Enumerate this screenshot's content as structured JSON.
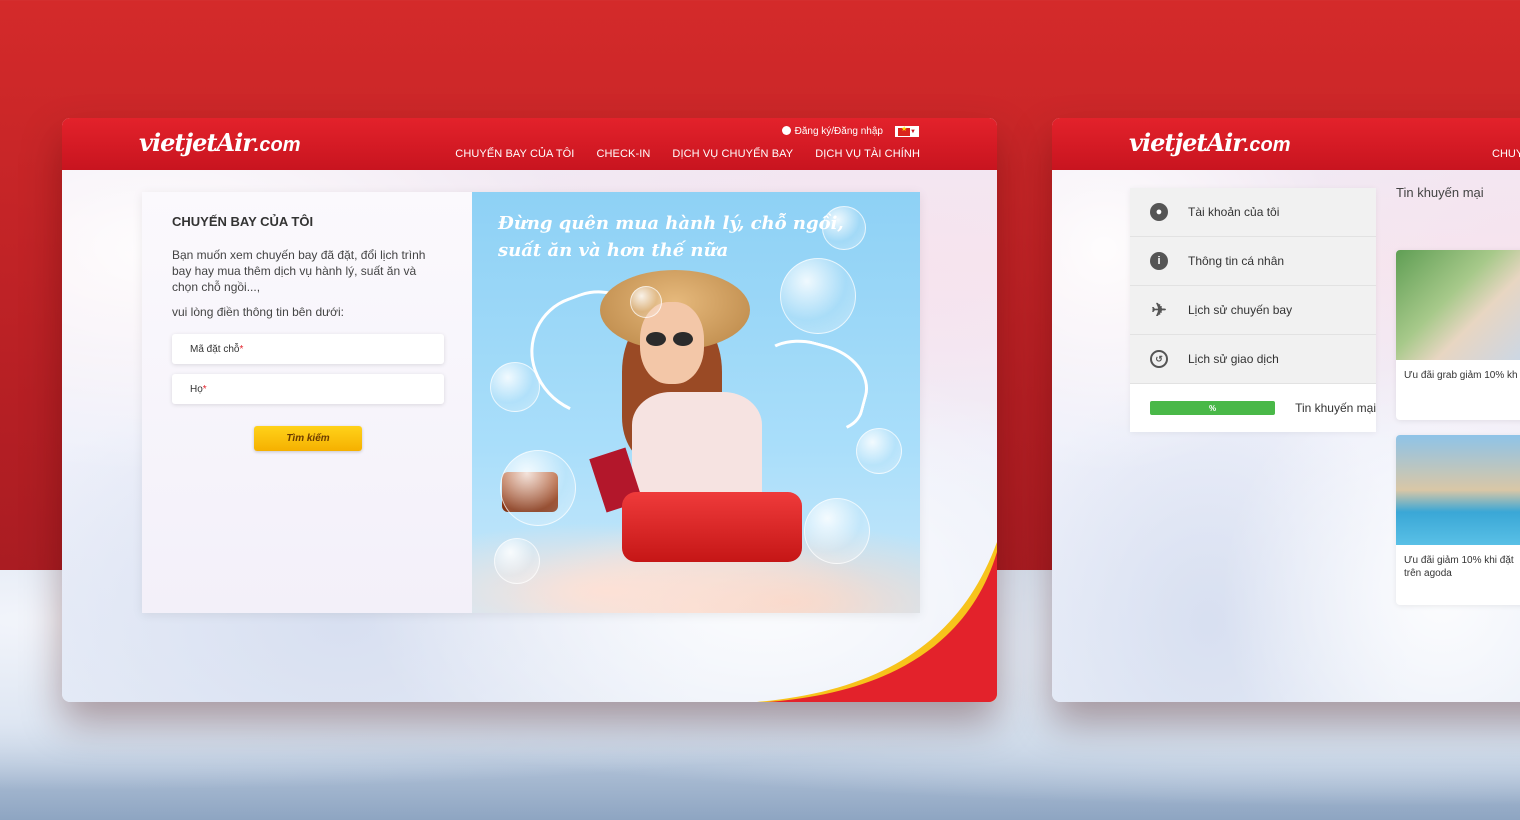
{
  "left_window": {
    "logo": {
      "main": "vietjetAir",
      "suffix": ".com"
    },
    "topbar": {
      "login_label": "Đăng ký/Đăng nhập",
      "flag": "vietnam-flag"
    },
    "nav": [
      "CHUYẾN BAY CỦA TÔI",
      "CHECK-IN",
      "DỊCH VỤ CHUYẾN BAY",
      "DỊCH VỤ TÀI CHÍNH"
    ],
    "form": {
      "title": "CHUYẾN BAY CỦA TÔI",
      "description": "Bạn muốn xem chuyến bay đã đặt, đổi lịch trình bay hay mua thêm dịch vụ hành lý, suất ăn và chọn chỗ ngồi...,",
      "instruction": "vui lòng điền thông tin bên dưới:",
      "booking_code_label": "Mã đặt chỗ",
      "last_name_label": "Họ",
      "required_mark": "*",
      "search_button": "Tìm kiếm"
    },
    "promo_banner": {
      "line1": "Đừng quên mua hành lý, chỗ ngồi,",
      "line2": "suất ăn và hơn thế nữa"
    }
  },
  "right_window": {
    "logo": {
      "main": "vietjetAir",
      "suffix": ".com"
    },
    "nav_partial": "CHUY",
    "sidebar": [
      {
        "label": "Tài khoản của tôi",
        "icon": "account-icon"
      },
      {
        "label": "Thông tin cá nhân",
        "icon": "info-icon"
      },
      {
        "label": "Lịch sử chuyến bay",
        "icon": "plane-icon"
      },
      {
        "label": "Lịch sử giao dịch",
        "icon": "history-icon"
      },
      {
        "label": "Tin khuyến mại",
        "icon": "promo-icon"
      }
    ],
    "promo_title": "Tin khuyến mại",
    "promo_cards": [
      {
        "text": "Ưu đãi grab giảm 10% kh"
      },
      {
        "text": "Ưu đãi giảm 10% khi đặt trên agoda"
      }
    ]
  },
  "colors": {
    "brand_red": "#e3222b",
    "brand_yellow": "#ffd21a",
    "promo_green": "#49b848"
  }
}
